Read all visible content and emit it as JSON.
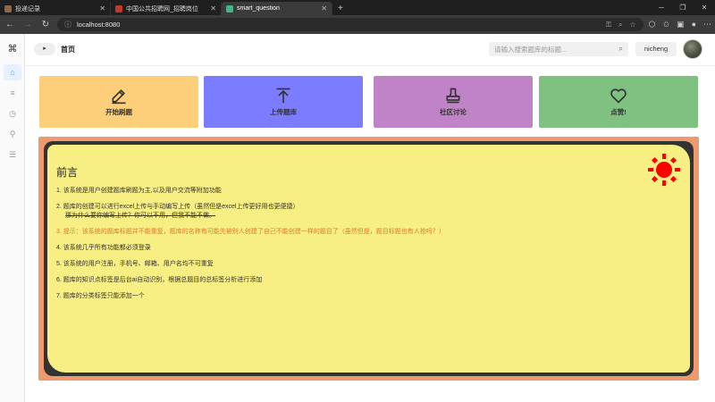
{
  "browser": {
    "tabs": [
      {
        "title": "投递记录",
        "fav_color": "#8a6a4a"
      },
      {
        "title": "中国公共招聘网_招聘岗位",
        "fav_color": "#c0392b"
      },
      {
        "title": "smart_question",
        "fav_color": "#41b883"
      }
    ],
    "url": "localhost:8080"
  },
  "sidebar": {
    "logo": "⌘"
  },
  "header": {
    "collapse_icon": "▸",
    "title": "首页",
    "search_placeholder": "请输入搜索题库的标题...",
    "username": "nicheng"
  },
  "tiles": [
    {
      "label": "开始刷题",
      "icon": "pencil-icon",
      "color": "#fdcf7a"
    },
    {
      "label": "上传题库",
      "icon": "upload-icon",
      "color": "#7b7cff"
    },
    {
      "label": "社区讨论",
      "icon": "stamp-icon",
      "color": "#c183c8"
    },
    {
      "label": "点赞!",
      "icon": "heart-icon",
      "color": "#7fc181"
    }
  ],
  "notice": {
    "title": "前言",
    "items": [
      "1. 该系统是用户创建题库刷题为主,以及用户交流等附加功能",
      "2. 题库的创建可以进行excel上传与手动编写上传（虽然但是excel上传更好用也更便捷）",
      "3. 提示：该系统的题库标题并不能重复，题库的名称有可能先被别人创建了自己不能创建一样的题目了（虽然但是，题目标题也有人抢吗？）",
      "4. 该系统几乎所有功能都必须登录",
      "5. 该系统的用户注册，手机号、邮箱、用户名均不可重复",
      "6. 题库的知识点标签是后台ai自动识别，根据总题目的总标签分析进行添加",
      "7. 题库的分类标签只能添加一个"
    ],
    "strike_line": "那为什么要你编写上传？你可以不用，但我不能不做。",
    "warn_color": "#e07a2a",
    "sun_color": "#ff0000"
  }
}
